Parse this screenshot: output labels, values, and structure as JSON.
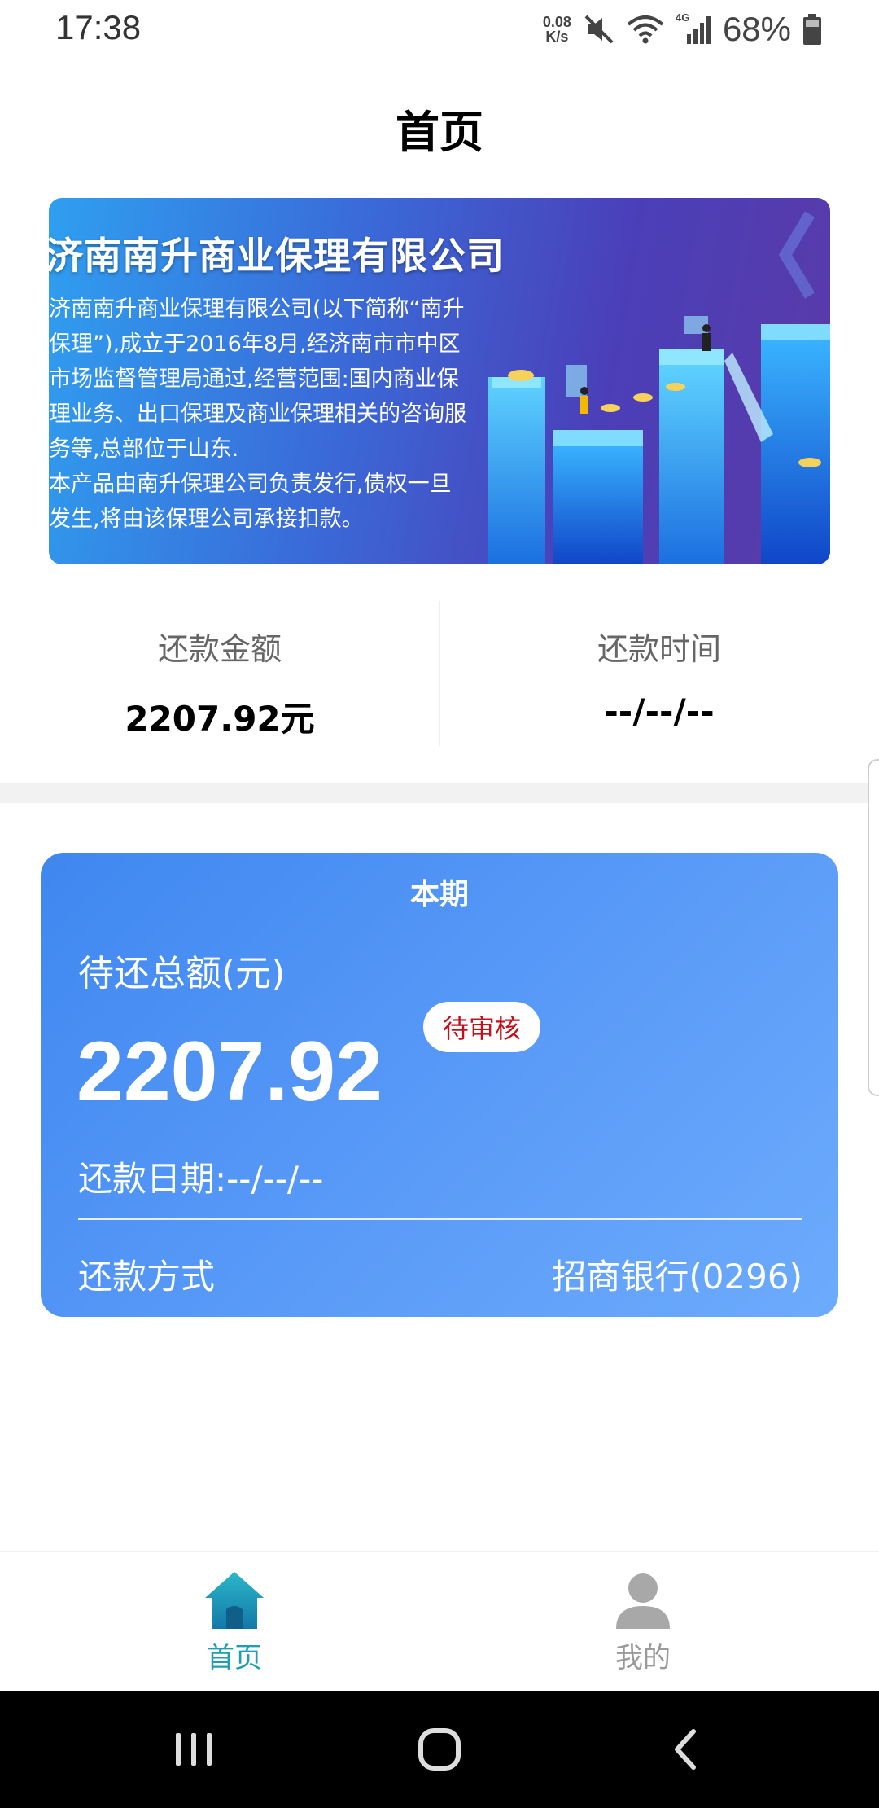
{
  "status_bar": {
    "time": "17:38",
    "net_speed_value": "0.08",
    "net_speed_unit": "K/s",
    "network_type": "4G",
    "battery": "68%",
    "icons": [
      "mute-icon",
      "wifi-icon",
      "signal-icon",
      "battery-icon"
    ]
  },
  "header": {
    "title": "首页"
  },
  "banner": {
    "company": "济南南升商业保理有限公司",
    "lines": [
      "济南南升商业保理有限公司(以下简称“南升",
      "保理”),成立于2016年8月,经济南市市中区",
      "市场监督管理局通过,经营范围:国内商业保",
      "理业务、出口保理及商业保理相关的咨询服",
      "务等,总部位于山东.",
      "本产品由南升保理公司负责发行,债权一旦",
      "发生,将由该保理公司承接扣款。"
    ]
  },
  "summary": {
    "amount_label": "还款金额",
    "amount_value": "2207.92元",
    "time_label": "还款时间",
    "time_value": "--/--/--"
  },
  "card": {
    "period": "本期",
    "amount_label": "待还总额(元)",
    "amount": "2207.92",
    "status_badge": "待审核",
    "date": "还款日期:--/--/--",
    "method_label": "还款方式",
    "method_value": "招商银行(0296)"
  },
  "tabbar": {
    "home_label": "首页",
    "mine_label": "我的",
    "active_color": "#1e9eb5",
    "inactive_color": "#9a9a9a"
  },
  "colors": {
    "card_start": "#3f87f0",
    "card_end": "#6cabfc",
    "badge_text": "#c0121a"
  }
}
